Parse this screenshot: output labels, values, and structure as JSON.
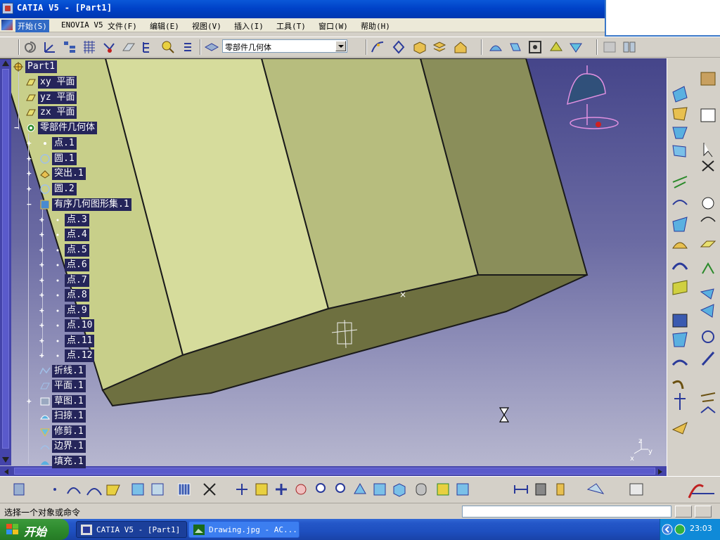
{
  "window": {
    "title": "CATIA V5 - [Part1]"
  },
  "menu": {
    "start": "开始(S)",
    "items": [
      "ENOVIA V5",
      "文件(F)",
      "编辑(E)",
      "视图(V)",
      "插入(I)",
      "工具(T)",
      "窗口(W)",
      "帮助(H)"
    ]
  },
  "toolbar": {
    "body_select": "零部件几何体"
  },
  "tree": {
    "root": "Part1",
    "planes": [
      "xy 平面",
      "yz 平面",
      "zx 平面"
    ],
    "body": "零部件几何体",
    "body_children": [
      "点.1",
      "圆.1",
      "突出.1",
      "圆.2",
      "有序几何图形集.1"
    ],
    "points": [
      "点.3",
      "点.4",
      "点.5",
      "点.6",
      "点.7",
      "点.8",
      "点.9",
      "点.10",
      "点.11",
      "点.12"
    ],
    "features": [
      "折线.1",
      "平面.1",
      "草图.1",
      "扫掠.1",
      "修剪.1",
      "边界.1",
      "填充.1"
    ]
  },
  "viewport": {
    "axis_labels": [
      "z",
      "x",
      "y"
    ]
  },
  "statusbar": {
    "prompt": "选择一个对象或命令"
  },
  "taskbar": {
    "start": "开始",
    "tasks": [
      "CATIA V5 - [Part1]",
      "Drawing.jpg - AC..."
    ],
    "clock": "23:03"
  },
  "colors": {
    "title_blue": "#0042c8",
    "tree_label_bg": "#25255a",
    "solid_face": "#d6dc9c",
    "viewport_top": "#45458a"
  }
}
